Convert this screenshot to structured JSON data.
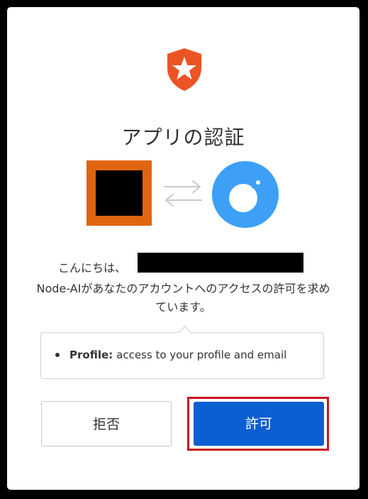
{
  "dialog": {
    "title": "アプリの認証",
    "greeting": "こんにちは、",
    "message": "Node-AIがあなたのアカウントへのアクセスの許可を求めています。",
    "scope_label": "Profile:",
    "scope_text": "access to your profile and email",
    "deny_label": "拒否",
    "allow_label": "許可"
  },
  "icons": {
    "logo": "auth0-shield-star-icon",
    "client_app": "app-icon",
    "swap": "swap-arrows-icon",
    "user_app": "node-ai-icon"
  },
  "colors": {
    "logo": "#eb5424",
    "accent": "#0a5fd2",
    "highlight": "#c8161e",
    "client_app_frame": "#e16510",
    "user_app": "#3da0f6"
  }
}
